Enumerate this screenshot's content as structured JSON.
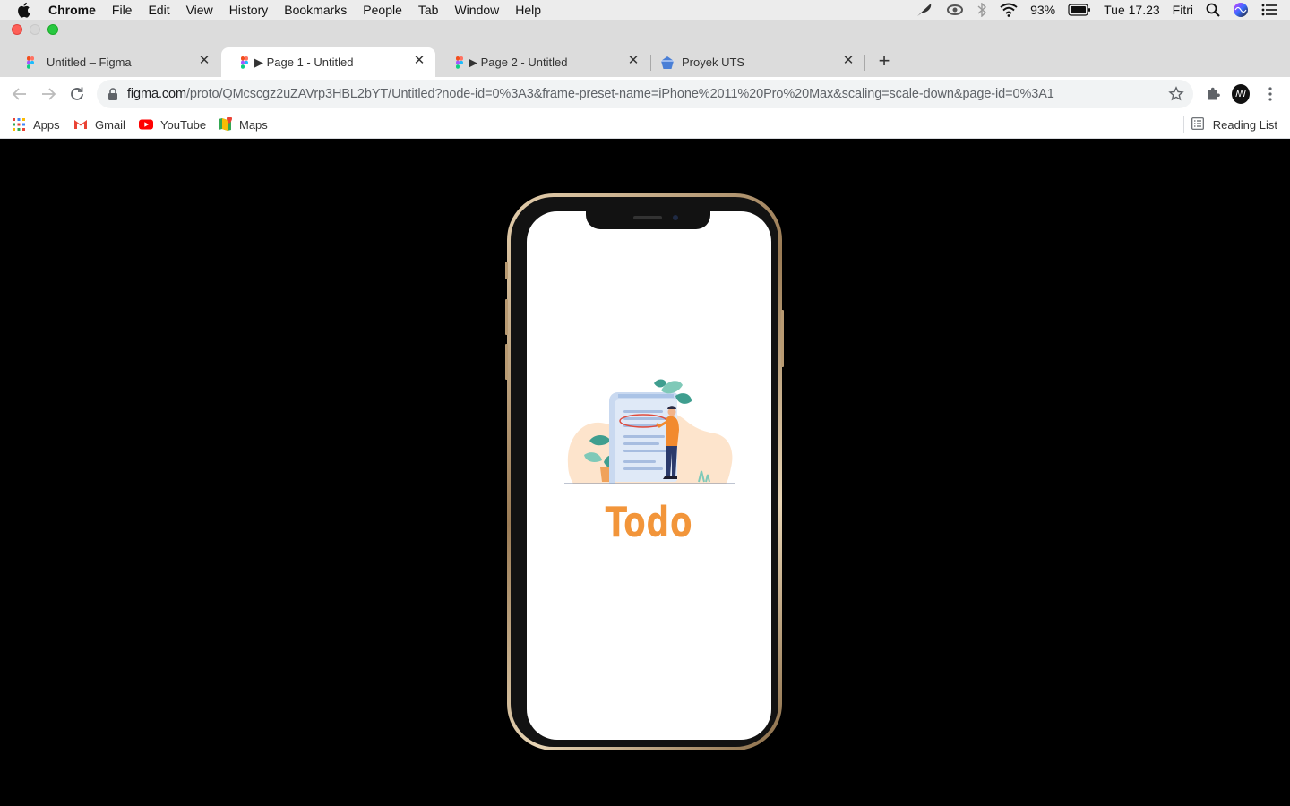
{
  "menubar": {
    "app_name": "Chrome",
    "menus": [
      "File",
      "Edit",
      "View",
      "History",
      "Bookmarks",
      "People",
      "Tab",
      "Window",
      "Help"
    ],
    "battery_percent": "93%",
    "clock": "Tue 17.23",
    "user": "Fitri"
  },
  "tabs": [
    {
      "title": "Untitled – Figma",
      "favicon": "figma-icon",
      "active": false
    },
    {
      "title": "▶ Page 1 - Untitled",
      "favicon": "figma-icon",
      "active": true
    },
    {
      "title": "▶ Page 2 - Untitled",
      "favicon": "figma-icon",
      "active": false
    },
    {
      "title": "Proyek UTS",
      "favicon": "pentagon-icon",
      "active": false
    }
  ],
  "omnibox": {
    "host": "figma.com",
    "path": "/proto/QMcscgz2uZAVrp3HBL2bYT/Untitled?node-id=0%3A3&frame-preset-name=iPhone%2011%20Pro%20Max&scaling=scale-down&page-id=0%3A1"
  },
  "bookmarks": [
    {
      "label": "Apps",
      "icon": "apps-grid-icon"
    },
    {
      "label": "Gmail",
      "icon": "gmail-icon"
    },
    {
      "label": "YouTube",
      "icon": "youtube-icon"
    },
    {
      "label": "Maps",
      "icon": "maps-icon"
    }
  ],
  "reading_list": "Reading List",
  "prototype": {
    "app_title": "Todo",
    "accent_color": "#f2953a"
  }
}
